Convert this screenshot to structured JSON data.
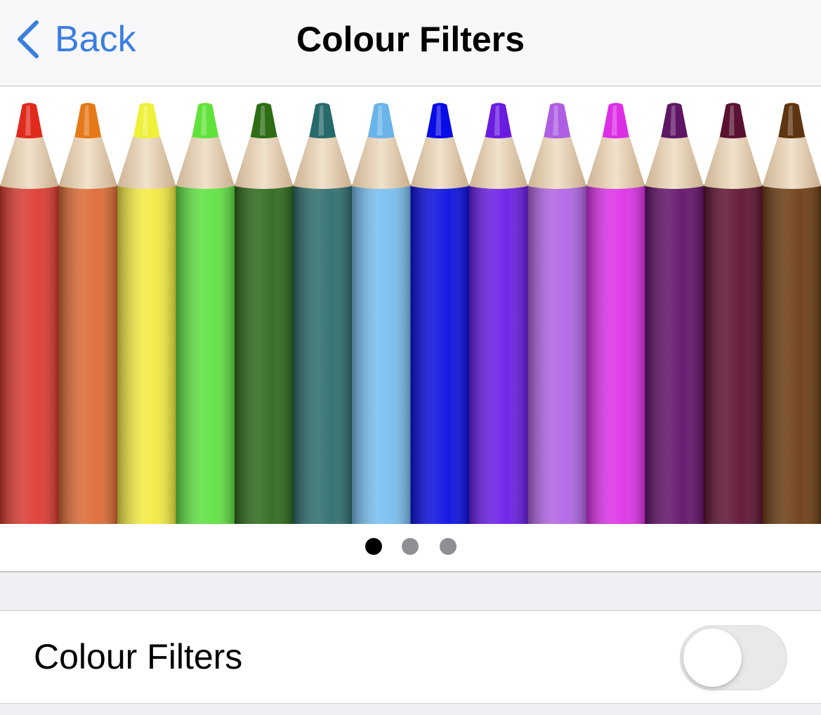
{
  "navbar": {
    "back_label": "Back",
    "title": "Colour Filters"
  },
  "preview": {
    "pencil_colors": [
      "#dc3b32",
      "#de6b35",
      "#f2ea43",
      "#5fe242",
      "#2e6a1c",
      "#2f6e6e",
      "#78bff0",
      "#0b0fe0",
      "#6a1de6",
      "#b165e4",
      "#dd33e8",
      "#63126a",
      "#5e1231",
      "#6d3d14"
    ],
    "tip_colors": [
      "#e02a1c",
      "#e57919",
      "#eef03a",
      "#60e23a",
      "#2c6d16",
      "#276a6a",
      "#6ab4ea",
      "#0a0ce6",
      "#6a1de0",
      "#ad5ee2",
      "#db2ee5",
      "#5e1564",
      "#5a1232",
      "#5e3510"
    ],
    "pages": 3,
    "current_page": 1
  },
  "settings": {
    "colour_filters_label": "Colour Filters",
    "colour_filters_on": false
  },
  "colors": {
    "accent": "#3b7ee0",
    "toggle_off": "#e9e9eb"
  }
}
